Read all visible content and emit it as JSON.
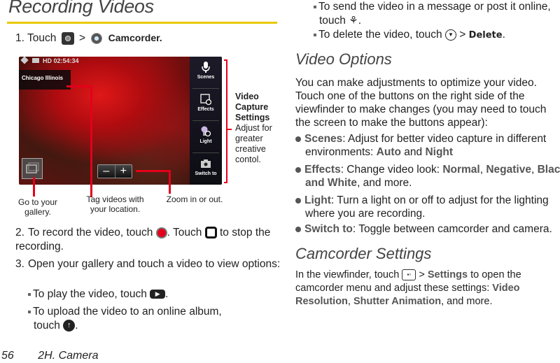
{
  "heading": "Recording Videos",
  "step1": {
    "num": "1.",
    "prefix": "Touch",
    "sep": ">",
    "target": "Camcorder."
  },
  "viewfinder": {
    "status_time": "HD 02:54:34",
    "location": "Chicago Illinois",
    "side_buttons": [
      {
        "label": "Scenes",
        "icon": "microphone-icon"
      },
      {
        "label": "Effects",
        "icon": "effects-icon"
      },
      {
        "label": "Light",
        "icon": "light-icon"
      },
      {
        "label": "Switch to",
        "icon": "camera-icon"
      }
    ],
    "zoom_minus": "–",
    "zoom_plus": "+"
  },
  "callouts": {
    "gallery": "Go to your gallery.",
    "tag": "Tag videos with your location.",
    "zoom": "Zoom in or out.",
    "settings_title": "Video Capture Settings",
    "settings_desc": "Adjust for greater creative contol."
  },
  "step2": {
    "num": "2.",
    "text1": "To record the video, touch",
    "text2": ". Touch",
    "text3": "to stop the recording."
  },
  "step3": {
    "num": "3.",
    "text": "Open your gallery and touch a video to view options:"
  },
  "bullets_left": [
    {
      "text": "To play the video, touch",
      "end": "."
    },
    {
      "text": "To upload the video to an online album, touch",
      "end": "."
    }
  ],
  "bullets_right": [
    {
      "text": "To send the video in a message or post it online, touch",
      "end": "."
    },
    {
      "text": "To delete the video, touch",
      "sep": ">",
      "bold": "Delete",
      "end": "."
    }
  ],
  "video_options": {
    "title": "Video Options",
    "intro": "You can make adjustments to optimize your video. Touch one of the buttons on the right side of the viewfinder to make changes (you may need to touch the screen to make the buttons appear):",
    "items": [
      {
        "term": "Scenes",
        "text": ": Adjust for better video capture in different environments: ",
        "b1": "Auto",
        "mid": " and ",
        "b2": "Night"
      },
      {
        "term": "Effects",
        "text": ": Change video look: ",
        "b1": "Normal",
        "mid": ", ",
        "b2": "Negative",
        "mid2": ", ",
        "b3": "Black and White",
        "end": ", and more."
      },
      {
        "term": "Light",
        "text": ": Turn a light on or off to adjust for the lighting where you are recording."
      },
      {
        "term": "Switch to",
        "text": ": Toggle between camcorder and camera."
      }
    ]
  },
  "camcorder_settings": {
    "title": "Camcorder Settings",
    "t1": "In the viewfinder, touch",
    "sep": ">",
    "b1": "Settings",
    "t2": "to open the camcorder menu and adjust these settings:",
    "b2": "Video Resolution",
    "t3": ",",
    "b3": "Shutter Animation",
    "t4": ", and more."
  },
  "footer": {
    "page": "56",
    "section": "2H. Camera"
  }
}
